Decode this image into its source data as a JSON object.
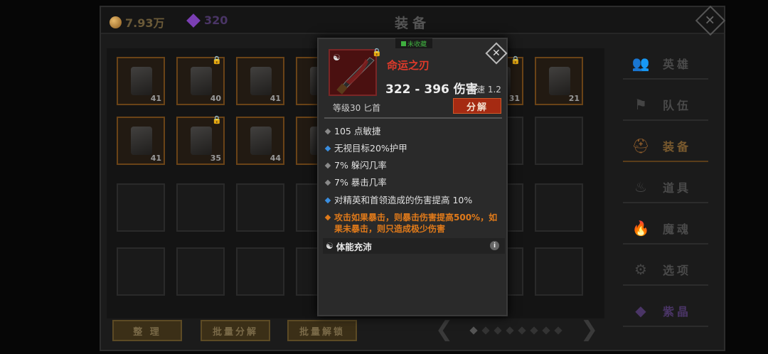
{
  "currency": {
    "gold": "7.93万",
    "gems": "320"
  },
  "screen_title": "装备",
  "grid": {
    "row1": [
      {
        "count": "41",
        "locked": false
      },
      {
        "count": "40",
        "locked": true
      },
      {
        "count": "41",
        "locked": false
      },
      {
        "count": "",
        "locked": false
      },
      {
        "count": "31",
        "locked": true
      },
      {
        "count": "21",
        "locked": false
      }
    ],
    "row2": [
      {
        "count": "41",
        "locked": false
      },
      {
        "count": "35",
        "locked": true
      },
      {
        "count": "44",
        "locked": false
      },
      {
        "count": "",
        "locked": false
      }
    ]
  },
  "bottom_buttons": {
    "sort": "整 理",
    "batch_dismantle": "批量分解",
    "batch_unlock": "批量解锁"
  },
  "pager": {
    "pages": 8,
    "active": 0
  },
  "sidebar": {
    "items": [
      {
        "label": "英雄",
        "icon": "hero-icon",
        "active": false
      },
      {
        "label": "队伍",
        "icon": "flag-icon",
        "active": false
      },
      {
        "label": "装备",
        "icon": "helmet-icon",
        "active": true
      },
      {
        "label": "道具",
        "icon": "bag-icon",
        "active": false
      },
      {
        "label": "魔魂",
        "icon": "flame-icon",
        "active": false
      },
      {
        "label": "选项",
        "icon": "gear-icon",
        "active": false
      },
      {
        "label": "紫晶",
        "icon": "crystal-icon",
        "active": false
      }
    ]
  },
  "tooltip": {
    "collection_status": "未收藏",
    "item_name": "命运之刃",
    "damage": "322 - 396 伤害",
    "attack_speed": "攻速 1.2",
    "level_type": "等级30 匕首",
    "dismantle_label": "分解",
    "stats": [
      {
        "text": "105 点敏捷",
        "color": "#8a8a8a",
        "text_color": "#e0e0e0"
      },
      {
        "text": "无视目标20%护甲",
        "color": "#3a8ee0",
        "text_color": "#e0e0e0"
      },
      {
        "text": "7% 躲闪几率",
        "color": "#8a8a8a",
        "text_color": "#e0e0e0"
      },
      {
        "text": "7% 暴击几率",
        "color": "#8a8a8a",
        "text_color": "#e0e0e0"
      },
      {
        "text": "对精英和首领造成的伤害提高 10%",
        "color": "#3a8ee0",
        "text_color": "#e0e0e0"
      },
      {
        "text": "攻击如果暴击，则暴击伤害提高500%，如果未暴击，则只造成极少伤害",
        "color": "#e07a1a",
        "text_color": "#e07a1a"
      }
    ],
    "perk": "体能充沛"
  },
  "colors": {
    "accent": "#a52a12",
    "legendary": "#e03a2a",
    "gold": "#d69a45",
    "gem": "#7b3fb4"
  }
}
